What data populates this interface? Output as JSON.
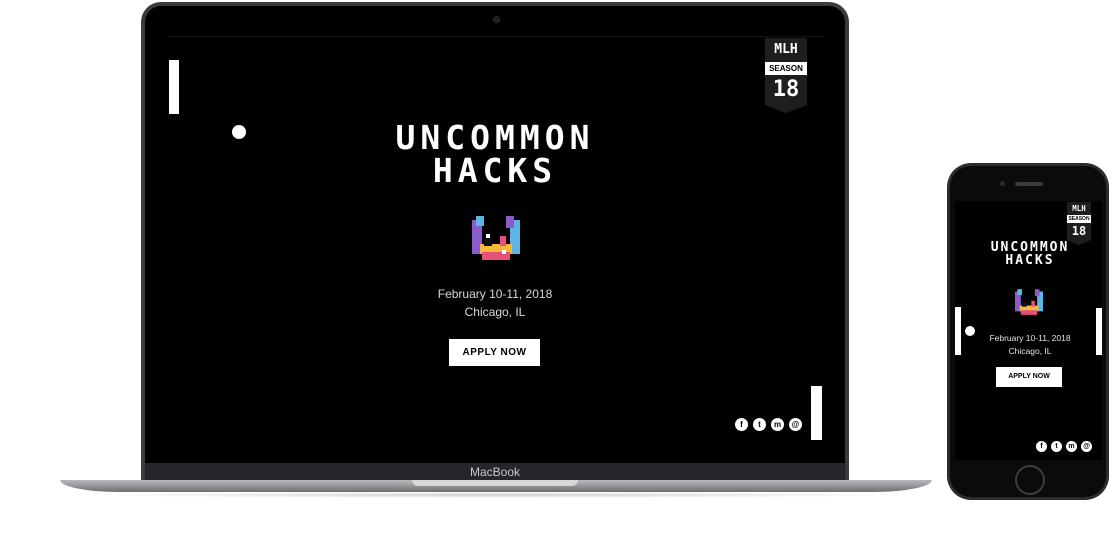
{
  "laptop": {
    "brand_label": "MacBook",
    "site": {
      "title_line1": "UNCOMMON",
      "title_line2": "HACKS",
      "date": "February 10-11, 2018",
      "location": "Chicago, IL",
      "apply_label": "APPLY NOW",
      "badge": {
        "top": "MLH",
        "middle": "SEASON",
        "number": "18"
      },
      "social": [
        {
          "icon": "facebook-icon",
          "glyph": "f"
        },
        {
          "icon": "twitter-icon",
          "glyph": "t"
        },
        {
          "icon": "messenger-icon",
          "glyph": "m"
        },
        {
          "icon": "email-icon",
          "glyph": "@"
        }
      ]
    }
  },
  "phone": {
    "site": {
      "title_line1": "UNCOMMON",
      "title_line2": "HACKS",
      "date": "February 10-11, 2018",
      "location": "Chicago, IL",
      "apply_label": "APPLY NOW",
      "badge": {
        "top": "MLH",
        "middle": "SEASON",
        "number": "18"
      },
      "social": [
        {
          "icon": "facebook-icon",
          "glyph": "f"
        },
        {
          "icon": "twitter-icon",
          "glyph": "t"
        },
        {
          "icon": "messenger-icon",
          "glyph": "m"
        },
        {
          "icon": "email-icon",
          "glyph": "@"
        }
      ]
    }
  },
  "colors": {
    "background": "#000000",
    "foreground": "#ffffff",
    "device_frame": "#3a3b3e"
  }
}
